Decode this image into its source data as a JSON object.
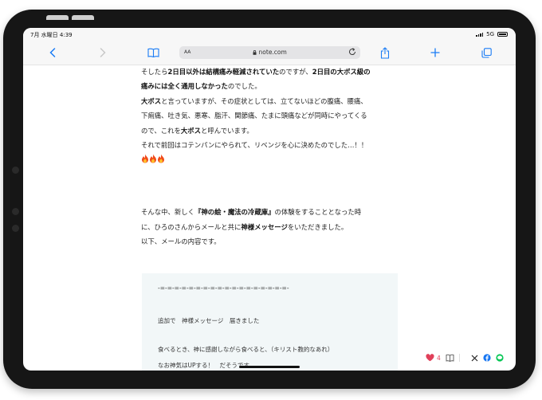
{
  "statusbar": {
    "time": "7月 水曜日 4:39",
    "network": "5G"
  },
  "toolbar": {
    "aa_label": "AA",
    "url": "note.com"
  },
  "article": {
    "lines": [
      [
        {
          "t": "そしたら"
        },
        {
          "t": "2日目以外は結構痛み軽減されていた",
          "b": true
        },
        {
          "t": "のですが、"
        },
        {
          "t": "2日目の大ボス級の",
          "b": true
        }
      ],
      [
        {
          "t": "痛みには全く通用しなかった",
          "b": true
        },
        {
          "t": "のでした。"
        }
      ],
      [
        {
          "t": "大ボス",
          "b": true
        },
        {
          "t": "と言っていますが、その症状としては、立てないほどの腹痛、腰痛、"
        }
      ],
      [
        {
          "t": "下痢痛、吐き気、悪寒、脂汗、関節痛、たまに頭痛などが同時にやってくる"
        }
      ],
      [
        {
          "t": "ので、これを"
        },
        {
          "t": "大ボス",
          "b": true
        },
        {
          "t": "と呼んでいます。"
        }
      ],
      [
        {
          "t": "それで前回はコテンパンにやられて、リベンジを心に決めたのでした…！！"
        }
      ]
    ],
    "fire_count": 3,
    "lines2": [
      [
        {
          "t": "そんな中、新しく"
        },
        {
          "t": "『神の絵・魔法の冷蔵庫』",
          "b": true
        },
        {
          "t": "の体験をすることとなった時"
        }
      ],
      [
        {
          "t": "に、ひろのさんからメールと共に"
        },
        {
          "t": "神様メッセージ",
          "b": true
        },
        {
          "t": "をいただきました。"
        }
      ],
      [
        {
          "t": "以下、メールの内容です。"
        }
      ]
    ]
  },
  "quote": {
    "divider": "-=-=-=-=-=-=-=-=-=-=-=-=-=-=-=-=-=-=-",
    "line1": "追加で　神様メッセージ　届きました",
    "line2": "食べるとき、神に感謝しながら食べると、（キリスト教的なあれ）",
    "line3": "なお神気はUPする！　だそうです"
  },
  "share": {
    "like_count": "4"
  },
  "colors": {
    "like": "#e0405a",
    "accent": "#1a7cf5",
    "facebook": "#1877f2",
    "line": "#06c755"
  }
}
